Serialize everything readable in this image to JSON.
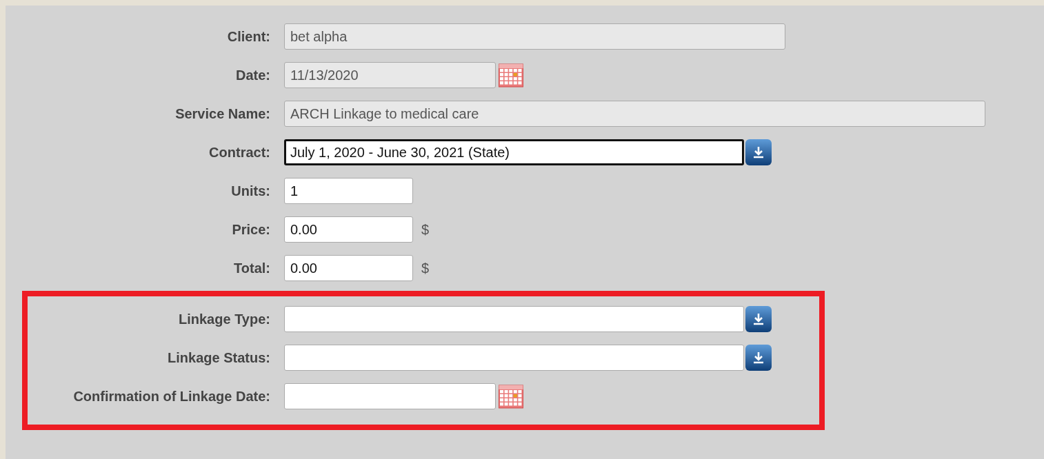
{
  "fields": [
    {
      "label": "Client:",
      "kind": "long_text",
      "value": "bet alpha",
      "disabled": true,
      "focused": false
    },
    {
      "label": "Date:",
      "kind": "date",
      "value": "11/13/2020",
      "disabled": true,
      "focused": false
    },
    {
      "label": "Service Name:",
      "kind": "wide_text",
      "value": "ARCH Linkage to medical care",
      "disabled": true,
      "focused": false
    },
    {
      "label": "Contract:",
      "kind": "select",
      "value": "July 1, 2020 - June 30, 2021 (State)",
      "disabled": false,
      "focused": true
    },
    {
      "label": "Units:",
      "kind": "number",
      "value": "1",
      "disabled": false,
      "focused": false
    },
    {
      "label": "Price:",
      "kind": "number",
      "value": "0.00",
      "suffix": "$",
      "disabled": false,
      "focused": false
    },
    {
      "label": "Total:",
      "kind": "number",
      "value": "0.00",
      "suffix": "$",
      "disabled": false,
      "focused": false
    }
  ],
  "highlighted_fields": [
    {
      "label": "Linkage Type:",
      "kind": "select",
      "disabled": false,
      "focused": false
    },
    {
      "label": "Linkage Status:",
      "kind": "select",
      "disabled": false,
      "focused": false
    },
    {
      "label": "Confirmation of Linkage Date:",
      "kind": "date",
      "disabled": false,
      "focused": false
    }
  ]
}
